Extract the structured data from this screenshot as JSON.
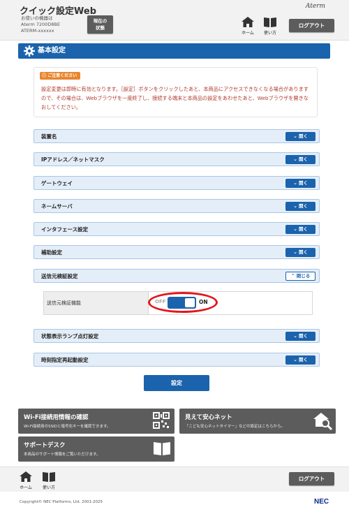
{
  "header": {
    "app_title": "クイック設定Web",
    "device_info_line1": "お使いの機器は",
    "device_info_line2": "Aterm 7200D8BE",
    "device_info_line3": "ATERM-xxxxxx",
    "status_button_line1": "現在の",
    "status_button_line2": "状態",
    "home_label": "ホーム",
    "howto_label": "使い方",
    "brand": "Aterm",
    "logout_label": "ログアウト"
  },
  "page": {
    "title": "基本設定"
  },
  "notice": {
    "tag": "ご注意ください",
    "text": "設定変更は即時に有効となります。［設定］ボタンをクリックしたあと、本商品にアクセスできなくなる場合がありますので、その場合は、Webブラウザを一度終了し、接続する端末と本商品の設定をあわせたあと、Webブラウザを開きなおしてください。"
  },
  "sections": [
    {
      "label": "装置名",
      "button": "開く",
      "state": "collapsed"
    },
    {
      "label": "IPアドレス／ネットマスク",
      "button": "開く",
      "state": "collapsed"
    },
    {
      "label": "ゲートウェイ",
      "button": "開く",
      "state": "collapsed"
    },
    {
      "label": "ネームサーバ",
      "button": "開く",
      "state": "collapsed"
    },
    {
      "label": "インタフェース設定",
      "button": "開く",
      "state": "collapsed"
    },
    {
      "label": "補助設定",
      "button": "開く",
      "state": "collapsed"
    },
    {
      "label": "送信元検証設定",
      "button": "閉じる",
      "state": "expanded"
    },
    {
      "label": "状態表示ランプ点灯設定",
      "button": "開く",
      "state": "collapsed"
    },
    {
      "label": "時刻指定再起動設定",
      "button": "開く",
      "state": "collapsed"
    }
  ],
  "source_validation": {
    "field_label": "送信元検証機能",
    "off_label": "OFF",
    "on_label": "ON",
    "value": "ON"
  },
  "apply_label": "設定",
  "tiles": [
    {
      "title": "Wi-Fi接続用情報の確認",
      "desc": "Wi-Fi接続用のSSIDと暗号化キーを確認できます。",
      "icon": "qr-code-icon"
    },
    {
      "title": "見えて安心ネット",
      "desc": "「こども安心ネットタイマー」などの設定はこちらから。",
      "icon": "home-search-icon"
    },
    {
      "title": "サポートデスク",
      "desc": "本商品のサポート情報をご覧いただけます。",
      "icon": "book-icon"
    }
  ],
  "footer": {
    "home_label": "ホーム",
    "howto_label": "使い方",
    "logout_label": "ログアウト",
    "copyright": "Copyright© NEC Platforms, Ltd. 2001-2025",
    "logo": "NEC"
  },
  "colors": {
    "primary": "#1b63ac",
    "header_gray": "#5c5c5c",
    "notice_orange": "#e8852e",
    "notice_text": "#b03a2e",
    "highlight_red": "#e2161b"
  }
}
